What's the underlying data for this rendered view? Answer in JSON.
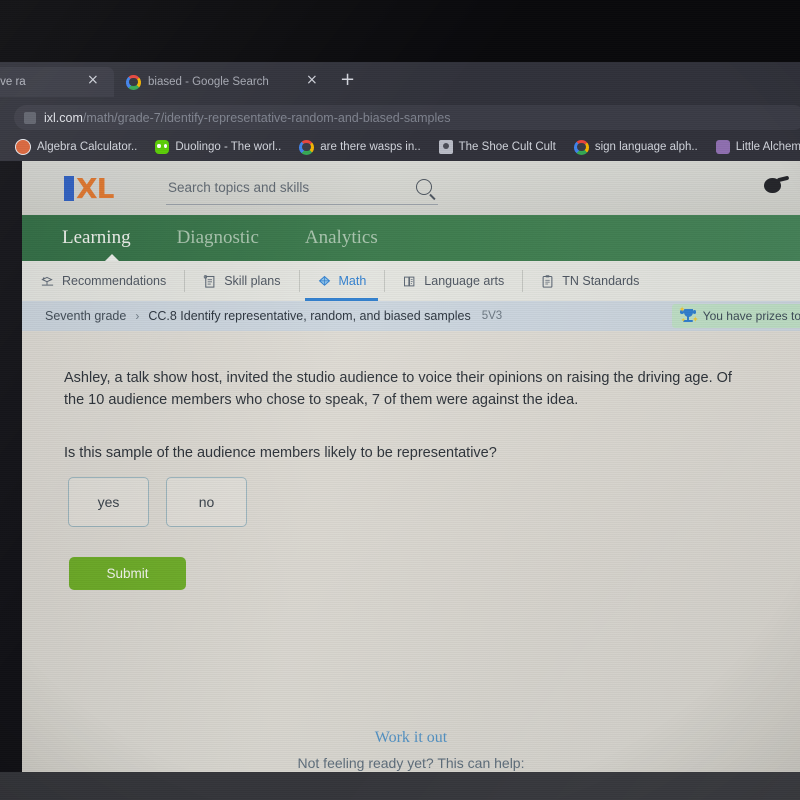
{
  "browser": {
    "tabs": [
      {
        "title": "resentative ra",
        "favicon": "none",
        "active": true,
        "close_label": "×"
      },
      {
        "title": "biased - Google Search",
        "favicon": "google-icon",
        "active": false,
        "close_label": "×"
      }
    ],
    "new_tab_label": "+",
    "url": {
      "host": "ixl.com",
      "path": "/math/grade-7/identify-representative-random-and-biased-samples"
    },
    "bookmarks": [
      {
        "label": "Algebra Calculator..",
        "icon": "algebra-calculator-icon"
      },
      {
        "label": "Duolingo - The worl..",
        "icon": "duolingo-icon"
      },
      {
        "label": "are there wasps in..",
        "icon": "google-icon"
      },
      {
        "label": "The Shoe Cult Cult",
        "icon": "shoe-icon"
      },
      {
        "label": "sign language alph..",
        "icon": "google-icon"
      },
      {
        "label": "Little Alchemy",
        "icon": "little-alchemy-icon"
      }
    ]
  },
  "ixl": {
    "logo": {
      "i": "I",
      "xl": "XL"
    },
    "search": {
      "placeholder": "Search topics and skills",
      "value": "",
      "icon": "search-icon"
    },
    "account_icon": "account-avatar-icon",
    "nav": [
      {
        "label": "Learning",
        "active": true
      },
      {
        "label": "Diagnostic",
        "active": false
      },
      {
        "label": "Analytics",
        "active": false
      }
    ],
    "subject_tabs": [
      {
        "label": "Recommendations",
        "icon": "recommendations-icon",
        "active": false
      },
      {
        "label": "Skill plans",
        "icon": "skill-plans-icon",
        "active": false
      },
      {
        "label": "Math",
        "icon": "math-icon",
        "active": true
      },
      {
        "label": "Language arts",
        "icon": "language-arts-icon",
        "active": false
      },
      {
        "label": "TN Standards",
        "icon": "standards-icon",
        "active": false
      }
    ],
    "breadcrumb": {
      "grade": "Seventh grade",
      "separator": "›",
      "skill": "CC.8 Identify representative, random, and biased samples",
      "code": "5V3"
    },
    "prize_banner": {
      "text": "You have prizes to rev",
      "icon": "trophy-icon"
    },
    "question": {
      "paragraph_1": "Ashley, a talk show host, invited the studio audience to voice their opinions on raising the driving age. Of the 10 audience members who chose to speak, 7 of them were against the idea.",
      "paragraph_2": "Is this sample of the audience members likely to be representative?",
      "choices": [
        {
          "label": "yes",
          "selected": false
        },
        {
          "label": "no",
          "selected": false
        }
      ],
      "submit_label": "Submit"
    },
    "footer": {
      "title": "Work it out",
      "subtitle": "Not feeling ready yet? This can help:"
    },
    "colors": {
      "brand_blue": "#2c5fc4",
      "brand_orange": "#e2762b",
      "nav_green": "#3c7c4c",
      "submit_green": "#6cab26",
      "active_tab_blue": "#2f7fd0",
      "link_blue": "#4e8fc2",
      "prize_banner_bg": "#bfe0c6"
    }
  }
}
